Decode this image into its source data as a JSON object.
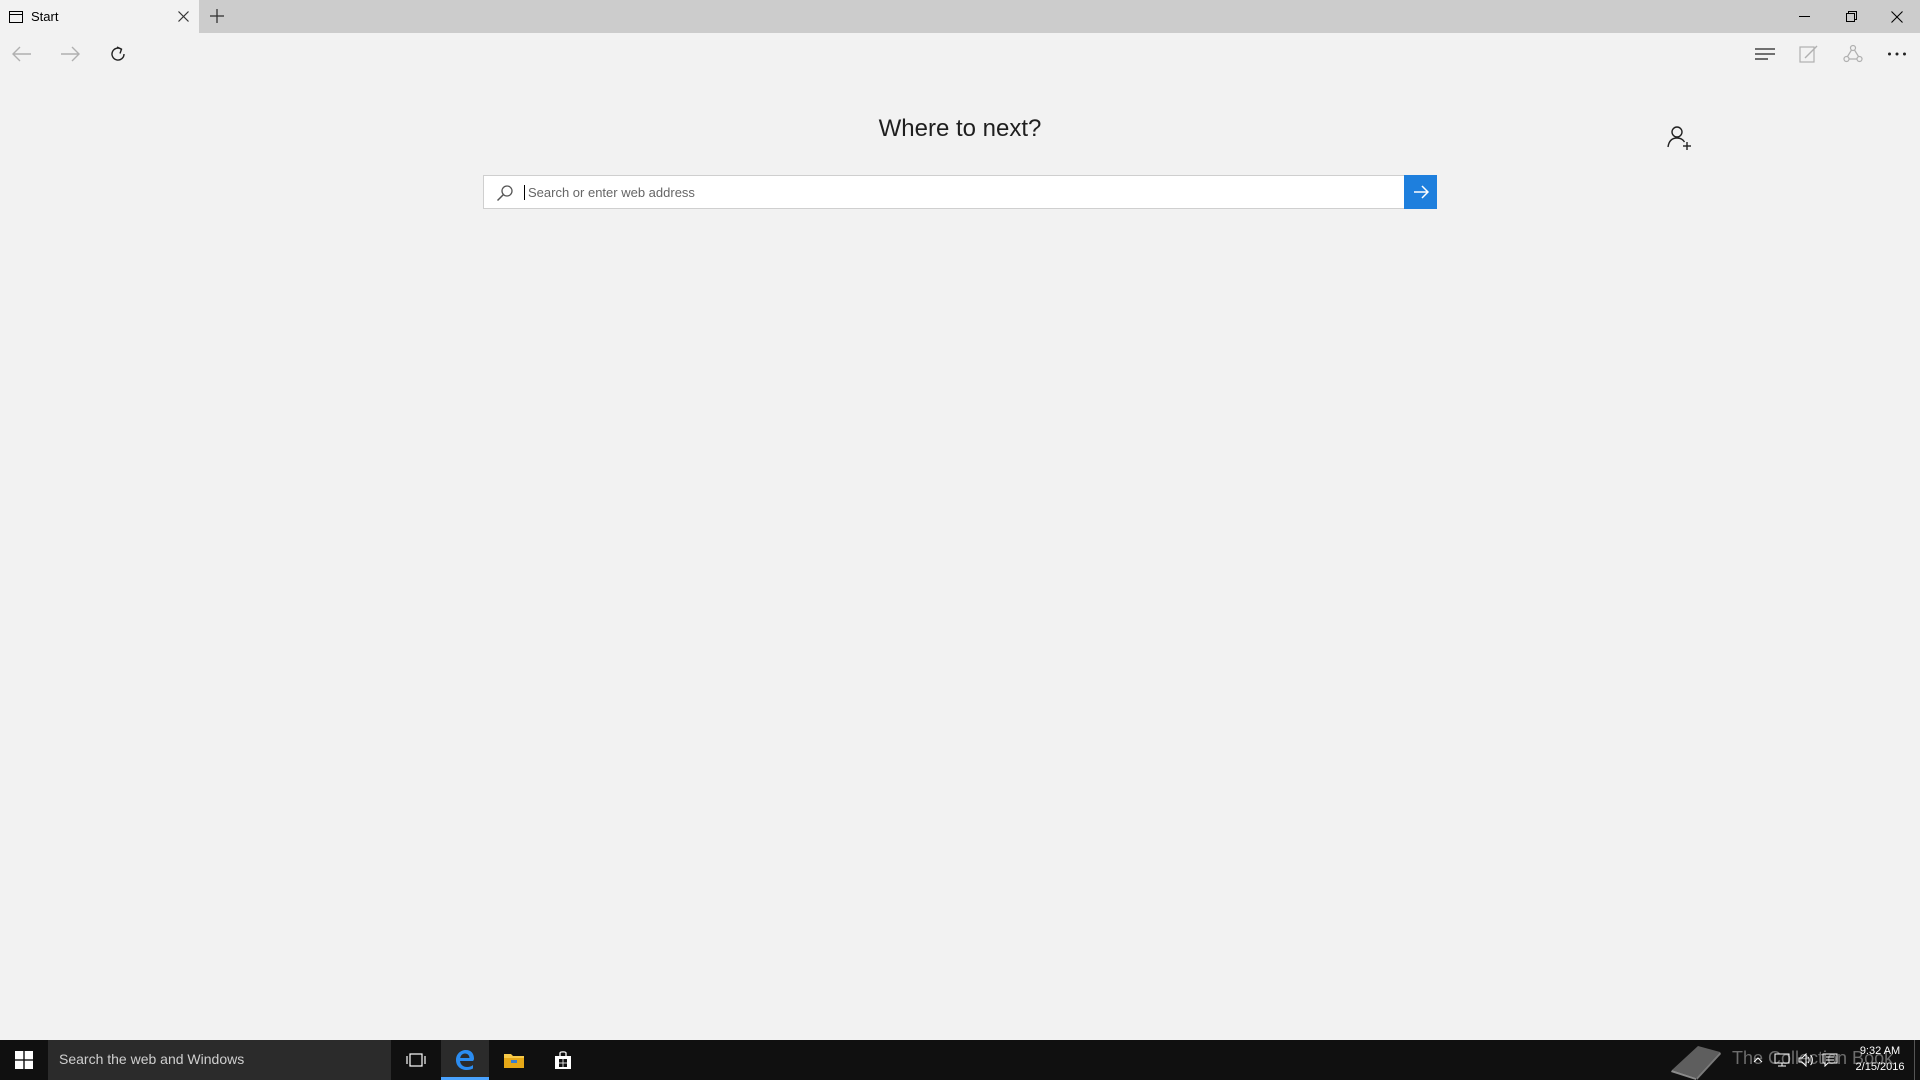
{
  "browser": {
    "tab": {
      "title": "Start",
      "icon": "tab-page-icon"
    },
    "new_tab_icon": "plus-icon",
    "window_controls": [
      "minimize-icon",
      "restore-icon",
      "close-icon"
    ],
    "toolbar": {
      "left": [
        "back-arrow-icon",
        "forward-arrow-icon",
        "refresh-icon"
      ],
      "right": [
        "hub-icon",
        "web-note-icon",
        "share-icon",
        "more-icon"
      ]
    }
  },
  "start_page": {
    "heading": "Where to next?",
    "search": {
      "placeholder": "Search or enter web address",
      "value": ""
    },
    "go_icon": "arrow-right-icon",
    "add_person_icon": "add-person-icon"
  },
  "taskbar": {
    "search_placeholder": "Search the web and Windows",
    "apps": [
      "task-view-icon",
      "edge-icon",
      "file-explorer-icon",
      "store-icon"
    ],
    "active_app": "edge-icon",
    "watermark": "The Collection Book",
    "clock": {
      "time": "9:32 AM",
      "date": "2/15/2016"
    },
    "accent_color": "#1e7fdd"
  }
}
